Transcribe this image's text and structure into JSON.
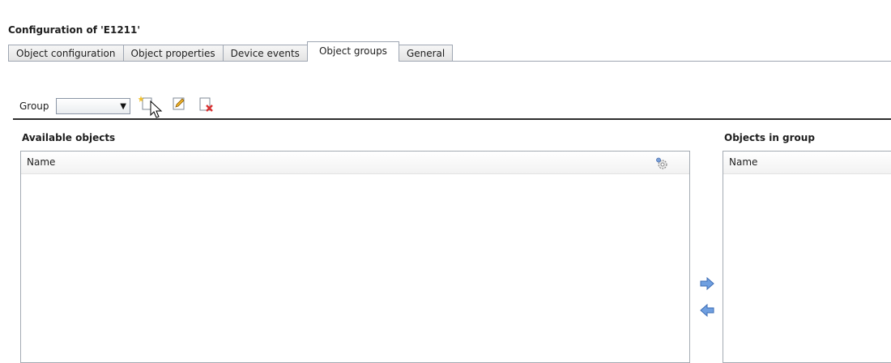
{
  "window": {
    "title": "Configuration of 'E1211'"
  },
  "tabs": [
    {
      "label": "Object configuration"
    },
    {
      "label": "Object properties"
    },
    {
      "label": "Device events"
    },
    {
      "label": "Object groups",
      "active": true
    },
    {
      "label": "General"
    }
  ],
  "group": {
    "label": "Group",
    "selected_value": "",
    "tools": [
      {
        "icon": "new-group-icon"
      },
      {
        "icon": "edit-group-icon"
      },
      {
        "icon": "delete-group-icon"
      }
    ]
  },
  "available": {
    "heading": "Available objects",
    "column_header": "Name",
    "header_icon": "settings-gear-icon",
    "items": []
  },
  "in_group": {
    "heading": "Objects in group",
    "column_header": "Name",
    "items": []
  },
  "move_buttons": {
    "add_icon": "arrow-right-icon",
    "remove_icon": "arrow-left-icon"
  },
  "colors": {
    "arrow_blue": "#6f9fe0",
    "border": "#a4abb3",
    "delete_red": "#d83030"
  }
}
